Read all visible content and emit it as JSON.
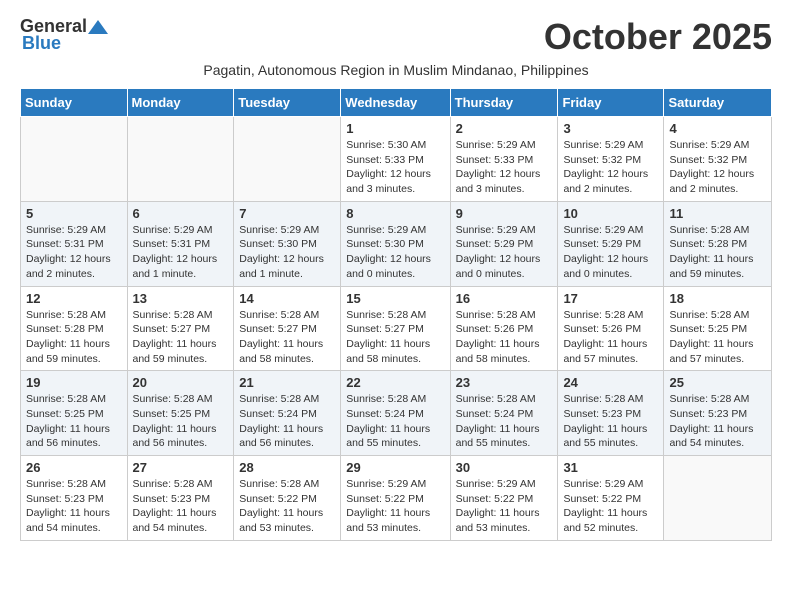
{
  "logo": {
    "general": "General",
    "blue": "Blue"
  },
  "title": "October 2025",
  "subtitle": "Pagatin, Autonomous Region in Muslim Mindanao, Philippines",
  "headers": [
    "Sunday",
    "Monday",
    "Tuesday",
    "Wednesday",
    "Thursday",
    "Friday",
    "Saturday"
  ],
  "weeks": [
    [
      {
        "day": "",
        "info": ""
      },
      {
        "day": "",
        "info": ""
      },
      {
        "day": "",
        "info": ""
      },
      {
        "day": "1",
        "info": "Sunrise: 5:30 AM\nSunset: 5:33 PM\nDaylight: 12 hours\nand 3 minutes."
      },
      {
        "day": "2",
        "info": "Sunrise: 5:29 AM\nSunset: 5:33 PM\nDaylight: 12 hours\nand 3 minutes."
      },
      {
        "day": "3",
        "info": "Sunrise: 5:29 AM\nSunset: 5:32 PM\nDaylight: 12 hours\nand 2 minutes."
      },
      {
        "day": "4",
        "info": "Sunrise: 5:29 AM\nSunset: 5:32 PM\nDaylight: 12 hours\nand 2 minutes."
      }
    ],
    [
      {
        "day": "5",
        "info": "Sunrise: 5:29 AM\nSunset: 5:31 PM\nDaylight: 12 hours\nand 2 minutes."
      },
      {
        "day": "6",
        "info": "Sunrise: 5:29 AM\nSunset: 5:31 PM\nDaylight: 12 hours\nand 1 minute."
      },
      {
        "day": "7",
        "info": "Sunrise: 5:29 AM\nSunset: 5:30 PM\nDaylight: 12 hours\nand 1 minute."
      },
      {
        "day": "8",
        "info": "Sunrise: 5:29 AM\nSunset: 5:30 PM\nDaylight: 12 hours\nand 0 minutes."
      },
      {
        "day": "9",
        "info": "Sunrise: 5:29 AM\nSunset: 5:29 PM\nDaylight: 12 hours\nand 0 minutes."
      },
      {
        "day": "10",
        "info": "Sunrise: 5:29 AM\nSunset: 5:29 PM\nDaylight: 12 hours\nand 0 minutes."
      },
      {
        "day": "11",
        "info": "Sunrise: 5:28 AM\nSunset: 5:28 PM\nDaylight: 11 hours\nand 59 minutes."
      }
    ],
    [
      {
        "day": "12",
        "info": "Sunrise: 5:28 AM\nSunset: 5:28 PM\nDaylight: 11 hours\nand 59 minutes."
      },
      {
        "day": "13",
        "info": "Sunrise: 5:28 AM\nSunset: 5:27 PM\nDaylight: 11 hours\nand 59 minutes."
      },
      {
        "day": "14",
        "info": "Sunrise: 5:28 AM\nSunset: 5:27 PM\nDaylight: 11 hours\nand 58 minutes."
      },
      {
        "day": "15",
        "info": "Sunrise: 5:28 AM\nSunset: 5:27 PM\nDaylight: 11 hours\nand 58 minutes."
      },
      {
        "day": "16",
        "info": "Sunrise: 5:28 AM\nSunset: 5:26 PM\nDaylight: 11 hours\nand 58 minutes."
      },
      {
        "day": "17",
        "info": "Sunrise: 5:28 AM\nSunset: 5:26 PM\nDaylight: 11 hours\nand 57 minutes."
      },
      {
        "day": "18",
        "info": "Sunrise: 5:28 AM\nSunset: 5:25 PM\nDaylight: 11 hours\nand 57 minutes."
      }
    ],
    [
      {
        "day": "19",
        "info": "Sunrise: 5:28 AM\nSunset: 5:25 PM\nDaylight: 11 hours\nand 56 minutes."
      },
      {
        "day": "20",
        "info": "Sunrise: 5:28 AM\nSunset: 5:25 PM\nDaylight: 11 hours\nand 56 minutes."
      },
      {
        "day": "21",
        "info": "Sunrise: 5:28 AM\nSunset: 5:24 PM\nDaylight: 11 hours\nand 56 minutes."
      },
      {
        "day": "22",
        "info": "Sunrise: 5:28 AM\nSunset: 5:24 PM\nDaylight: 11 hours\nand 55 minutes."
      },
      {
        "day": "23",
        "info": "Sunrise: 5:28 AM\nSunset: 5:24 PM\nDaylight: 11 hours\nand 55 minutes."
      },
      {
        "day": "24",
        "info": "Sunrise: 5:28 AM\nSunset: 5:23 PM\nDaylight: 11 hours\nand 55 minutes."
      },
      {
        "day": "25",
        "info": "Sunrise: 5:28 AM\nSunset: 5:23 PM\nDaylight: 11 hours\nand 54 minutes."
      }
    ],
    [
      {
        "day": "26",
        "info": "Sunrise: 5:28 AM\nSunset: 5:23 PM\nDaylight: 11 hours\nand 54 minutes."
      },
      {
        "day": "27",
        "info": "Sunrise: 5:28 AM\nSunset: 5:23 PM\nDaylight: 11 hours\nand 54 minutes."
      },
      {
        "day": "28",
        "info": "Sunrise: 5:28 AM\nSunset: 5:22 PM\nDaylight: 11 hours\nand 53 minutes."
      },
      {
        "day": "29",
        "info": "Sunrise: 5:29 AM\nSunset: 5:22 PM\nDaylight: 11 hours\nand 53 minutes."
      },
      {
        "day": "30",
        "info": "Sunrise: 5:29 AM\nSunset: 5:22 PM\nDaylight: 11 hours\nand 53 minutes."
      },
      {
        "day": "31",
        "info": "Sunrise: 5:29 AM\nSunset: 5:22 PM\nDaylight: 11 hours\nand 52 minutes."
      },
      {
        "day": "",
        "info": ""
      }
    ]
  ]
}
